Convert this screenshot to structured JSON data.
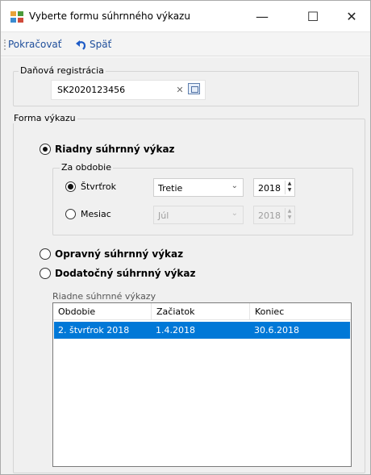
{
  "window": {
    "title": "Vyberte formu súhrnného výkazu",
    "controls": {
      "minimize": "—",
      "maximize": "☐",
      "close": "✕"
    }
  },
  "toolbar": {
    "continue_label": "Pokračovať",
    "back_label": "Späť"
  },
  "tax_registration": {
    "caption": "Daňová registrácia",
    "value": "SK2020123456",
    "clear_glyph": "✕"
  },
  "report_form": {
    "caption": "Forma výkazu",
    "options": {
      "regular": {
        "label": "Riadny súhrnný výkaz",
        "selected": true
      },
      "corrective": {
        "label": "Opravný súhrnný výkaz",
        "selected": false
      },
      "supplementary": {
        "label": "Dodatočný súhrnný výkaz",
        "selected": false
      }
    },
    "period": {
      "caption": "Za obdobie",
      "quarter": {
        "label": "Štvrťrok",
        "selected": true,
        "value": "Tretie",
        "year": "2018"
      },
      "month": {
        "label": "Mesiac",
        "selected": false,
        "value": "Júl",
        "year": "2018",
        "disabled": true
      }
    }
  },
  "reports_list": {
    "label": "Riadne súhrnné výkazy",
    "columns": [
      "Obdobie",
      "Začiatok",
      "Koniec"
    ],
    "rows": [
      {
        "period": "2. štvrťrok 2018",
        "start": "1.4.2018",
        "end": "30.6.2018",
        "selected": true
      }
    ]
  },
  "icons": {
    "app": "app-icon",
    "back": "undo-arrow-icon",
    "clear": "close-icon",
    "picker": "calendar-icon",
    "dropdown": "chevron-down-icon",
    "spin": "spinner-arrows-icon"
  },
  "colors": {
    "selection": "#0078d7",
    "toolbar_text": "#1e4e9b",
    "panel_background": "#f0f0f0"
  }
}
